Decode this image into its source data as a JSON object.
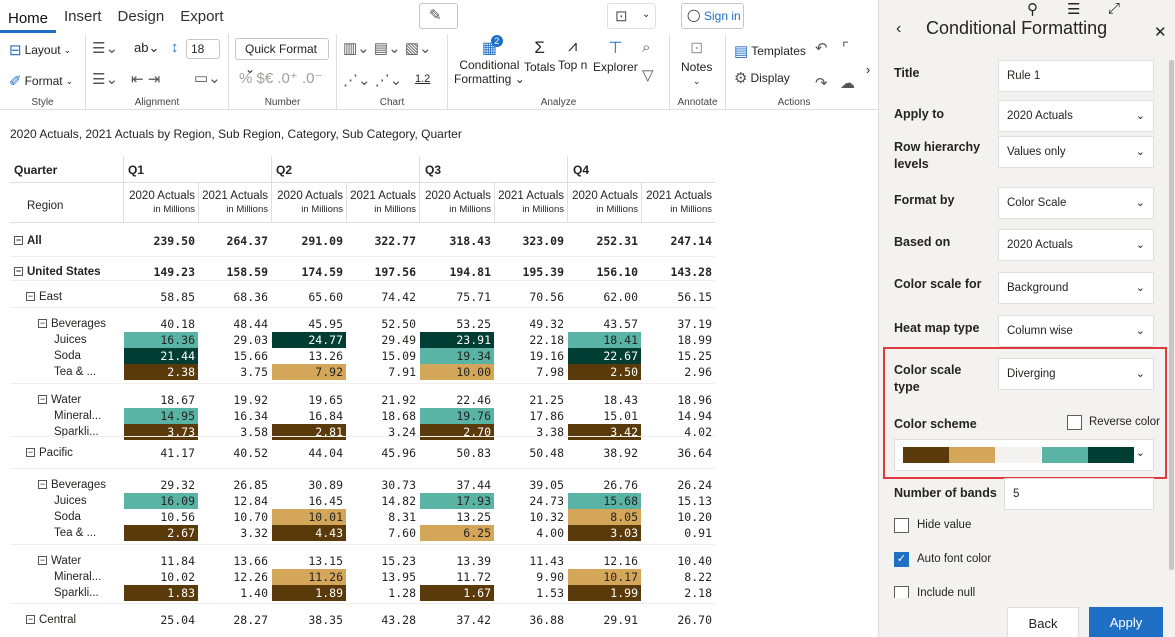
{
  "ribbon": {
    "tabs": [
      "Home",
      "Insert",
      "Design",
      "Export"
    ],
    "sign_in": "Sign in",
    "layout": "Layout",
    "format": "Format",
    "font_size": "18",
    "quick_format": "Quick Format",
    "style_label": "Style",
    "alignment_label": "Alignment",
    "number_label": "Number",
    "chart_label": "Chart",
    "analyze_label": "Analyze",
    "annotate_label": "Annotate",
    "actions_label": "Actions",
    "conditional": "Conditional",
    "formatting": "Formatting",
    "totals": "Totals",
    "topn": "Top n",
    "explorer": "Explorer",
    "notes": "Notes",
    "templates": "Templates",
    "display": "Display",
    "cf_badge": "2",
    "number_chars": "% $€ .0⁺ .0⁻",
    "chart_num": "1.2"
  },
  "subtitle": "2020 Actuals, 2021 Actuals by Region, Sub Region, Category, Sub Category, Quarter",
  "table": {
    "quarter_header": "Quarter",
    "region_header": "Region",
    "quarters": [
      "Q1",
      "Q2",
      "Q3",
      "Q4"
    ],
    "col_main": [
      "2020 Actuals",
      "2021 Actuals",
      "2020 Actuals",
      "2021 Actuals",
      "2020 Actuals",
      "2021 Actuals",
      "2020 Actuals",
      "2021 Actuals"
    ],
    "col_sub": "in Millions",
    "rows": [
      {
        "label": "All",
        "level": 0,
        "bold": true,
        "toggle": true,
        "values": [
          "239.50",
          "264.37",
          "291.09",
          "322.77",
          "318.43",
          "323.09",
          "252.31",
          "247.14"
        ],
        "bg": []
      },
      {
        "label": "United States",
        "level": 0,
        "bold": true,
        "toggle": true,
        "values": [
          "149.23",
          "158.59",
          "174.59",
          "197.56",
          "194.81",
          "195.39",
          "156.10",
          "143.28"
        ],
        "bg": []
      },
      {
        "label": "East",
        "level": 1,
        "bold": false,
        "toggle": true,
        "values": [
          "58.85",
          "68.36",
          "65.60",
          "74.42",
          "75.71",
          "70.56",
          "62.00",
          "56.15"
        ],
        "bg": []
      },
      {
        "label": "Beverages",
        "level": 2,
        "bold": false,
        "toggle": true,
        "values": [
          "40.18",
          "48.44",
          "45.95",
          "52.50",
          "53.25",
          "49.32",
          "43.57",
          "37.19"
        ],
        "bg": []
      },
      {
        "label": "Juices",
        "level": 3,
        "bold": false,
        "toggle": false,
        "values": [
          "16.36",
          "29.03",
          "24.77",
          "29.49",
          "23.91",
          "22.18",
          "18.41",
          "18.99"
        ],
        "bg": [
          "t",
          "",
          "d",
          "",
          "d",
          "",
          "t",
          ""
        ]
      },
      {
        "label": "Soda",
        "level": 3,
        "bold": false,
        "toggle": false,
        "values": [
          "21.44",
          "15.66",
          "13.26",
          "15.09",
          "19.34",
          "19.16",
          "22.67",
          "15.25"
        ],
        "bg": [
          "d",
          "",
          "",
          "",
          "t",
          "",
          "d",
          ""
        ]
      },
      {
        "label": "Tea & ...",
        "level": 3,
        "bold": false,
        "toggle": false,
        "values": [
          "2.38",
          "3.75",
          "7.92",
          "7.91",
          "10.00",
          "7.98",
          "2.50",
          "2.96"
        ],
        "bg": [
          "b",
          "",
          "g",
          "",
          "g",
          "",
          "b",
          ""
        ]
      },
      {
        "label": "Water",
        "level": 2,
        "bold": false,
        "toggle": true,
        "values": [
          "18.67",
          "19.92",
          "19.65",
          "21.92",
          "22.46",
          "21.25",
          "18.43",
          "18.96"
        ],
        "bg": []
      },
      {
        "label": "Mineral...",
        "level": 3,
        "bold": false,
        "toggle": false,
        "values": [
          "14.95",
          "16.34",
          "16.84",
          "18.68",
          "19.76",
          "17.86",
          "15.01",
          "14.94"
        ],
        "bg": [
          "t",
          "",
          "",
          "",
          "t",
          "",
          "",
          ""
        ]
      },
      {
        "label": "Sparkli...",
        "level": 3,
        "bold": false,
        "toggle": false,
        "values": [
          "3.73",
          "3.58",
          "2.81",
          "3.24",
          "2.70",
          "3.38",
          "3.42",
          "4.02"
        ],
        "bg": [
          "b",
          "",
          "b",
          "",
          "b",
          "",
          "b",
          ""
        ]
      },
      {
        "label": "Pacific",
        "level": 1,
        "bold": false,
        "toggle": true,
        "values": [
          "41.17",
          "40.52",
          "44.04",
          "45.96",
          "50.83",
          "50.48",
          "38.92",
          "36.64"
        ],
        "bg": []
      },
      {
        "label": "Beverages",
        "level": 2,
        "bold": false,
        "toggle": true,
        "values": [
          "29.32",
          "26.85",
          "30.89",
          "30.73",
          "37.44",
          "39.05",
          "26.76",
          "26.24"
        ],
        "bg": []
      },
      {
        "label": "Juices",
        "level": 3,
        "bold": false,
        "toggle": false,
        "values": [
          "16.09",
          "12.84",
          "16.45",
          "14.82",
          "17.93",
          "24.73",
          "15.68",
          "15.13"
        ],
        "bg": [
          "t",
          "",
          "",
          "",
          "t",
          "",
          "t",
          ""
        ]
      },
      {
        "label": "Soda",
        "level": 3,
        "bold": false,
        "toggle": false,
        "values": [
          "10.56",
          "10.70",
          "10.01",
          "8.31",
          "13.25",
          "10.32",
          "8.05",
          "10.20"
        ],
        "bg": [
          "",
          "",
          "g",
          "",
          "",
          "",
          "g",
          ""
        ]
      },
      {
        "label": "Tea & ...",
        "level": 3,
        "bold": false,
        "toggle": false,
        "values": [
          "2.67",
          "3.32",
          "4.43",
          "7.60",
          "6.25",
          "4.00",
          "3.03",
          "0.91"
        ],
        "bg": [
          "b",
          "",
          "b",
          "",
          "g",
          "",
          "b",
          ""
        ]
      },
      {
        "label": "Water",
        "level": 2,
        "bold": false,
        "toggle": true,
        "values": [
          "11.84",
          "13.66",
          "13.15",
          "15.23",
          "13.39",
          "11.43",
          "12.16",
          "10.40"
        ],
        "bg": []
      },
      {
        "label": "Mineral...",
        "level": 3,
        "bold": false,
        "toggle": false,
        "values": [
          "10.02",
          "12.26",
          "11.26",
          "13.95",
          "11.72",
          "9.90",
          "10.17",
          "8.22"
        ],
        "bg": [
          "",
          "",
          "g",
          "",
          "",
          "",
          "g",
          ""
        ]
      },
      {
        "label": "Sparkli...",
        "level": 3,
        "bold": false,
        "toggle": false,
        "values": [
          "1.83",
          "1.40",
          "1.89",
          "1.28",
          "1.67",
          "1.53",
          "1.99",
          "2.18"
        ],
        "bg": [
          "b",
          "",
          "b",
          "",
          "b",
          "",
          "b",
          ""
        ]
      },
      {
        "label": "Central",
        "level": 1,
        "bold": false,
        "toggle": true,
        "values": [
          "25.04",
          "28.27",
          "38.35",
          "43.28",
          "37.42",
          "36.88",
          "29.91",
          "26.70"
        ],
        "bg": []
      }
    ]
  },
  "colors": {
    "d": "#003d33",
    "t": "#5ab4a5",
    "g": "#d4a65a",
    "b": "#5a3a0a",
    "accent": "#1f6fc5",
    "highlight_border": "#e0393e"
  },
  "pane": {
    "title": "Conditional Formatting",
    "fields": [
      {
        "label": "Title",
        "value": "Rule 1",
        "type": "input"
      },
      {
        "label": "Apply to",
        "value": "2020 Actuals",
        "type": "select"
      },
      {
        "label": "Row hierarchy levels",
        "value": "Values only",
        "type": "select"
      },
      {
        "label": "Format by",
        "value": "Color Scale",
        "type": "select"
      },
      {
        "label": "Based on",
        "value": "2020 Actuals",
        "type": "select"
      },
      {
        "label": "Color scale for",
        "value": "Background",
        "type": "select"
      },
      {
        "label": "Heat map type",
        "value": "Column wise",
        "type": "select"
      },
      {
        "label": "Color scale type",
        "value": "Diverging",
        "type": "select"
      }
    ],
    "color_scheme_label": "Color scheme",
    "reverse_color": "Reverse color",
    "scheme_colors": [
      "#5a3a0a",
      "#d4a65a",
      "#f3f2f1",
      "#5ab4a5",
      "#003d33"
    ],
    "bands_label": "Number of bands",
    "bands_value": "5",
    "hide_value": "Hide value",
    "auto_font_color": "Auto font color",
    "include_null": "Include null",
    "back": "Back",
    "apply": "Apply"
  }
}
